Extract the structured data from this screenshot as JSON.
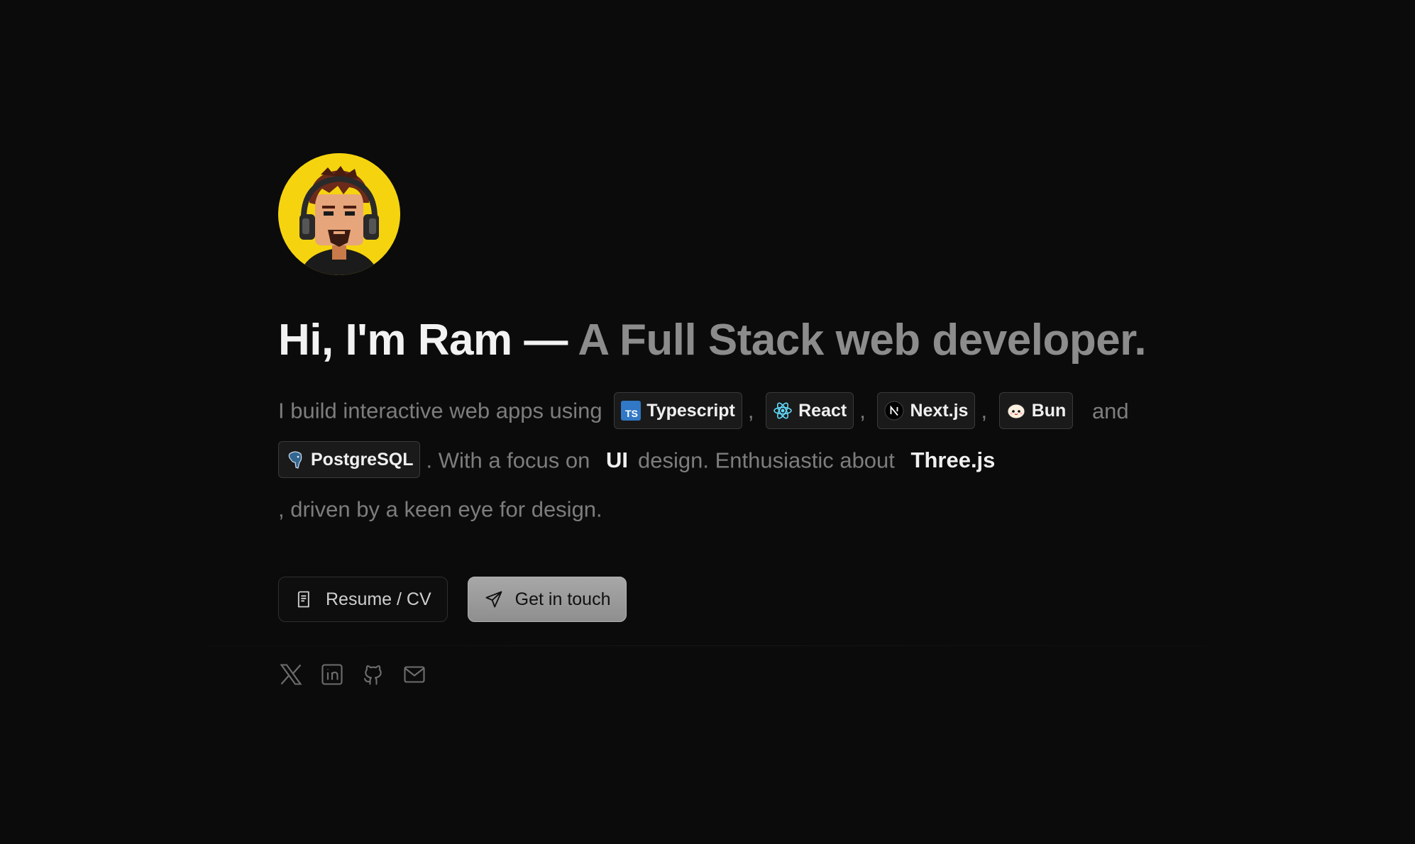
{
  "hero": {
    "title_main": "Hi, I'm Ram — ",
    "title_accent": "A Full Stack web developer."
  },
  "bio": {
    "intro": "I build interactive web apps using",
    "sep1": ",",
    "sep2": ",",
    "sep3": ",",
    "and": "and",
    "focus_text": ". With a focus on",
    "focus_strong": "UI",
    "enthusiast_text": "design. Enthusiastic about",
    "enthusiast_strong": "Three.js",
    "closing": ", driven by a keen eye for design.",
    "tech": [
      {
        "label": "Typescript",
        "icon": "typescript-icon"
      },
      {
        "label": "React",
        "icon": "react-icon"
      },
      {
        "label": "Next.js",
        "icon": "nextjs-icon"
      },
      {
        "label": "Bun",
        "icon": "bun-icon"
      },
      {
        "label": "PostgreSQL",
        "icon": "postgresql-icon"
      }
    ]
  },
  "actions": {
    "resume_label": "Resume / CV",
    "contact_label": "Get in touch"
  },
  "socials": [
    {
      "icon": "x-twitter-icon"
    },
    {
      "icon": "linkedin-icon"
    },
    {
      "icon": "github-icon"
    },
    {
      "icon": "mail-icon"
    }
  ],
  "colors": {
    "background": "#0b0b0b",
    "avatar_bg": "#f5d40f",
    "title": "#f2f2f2",
    "title_accent": "#8c8c8c",
    "primary_button": "#9a9a9a"
  }
}
